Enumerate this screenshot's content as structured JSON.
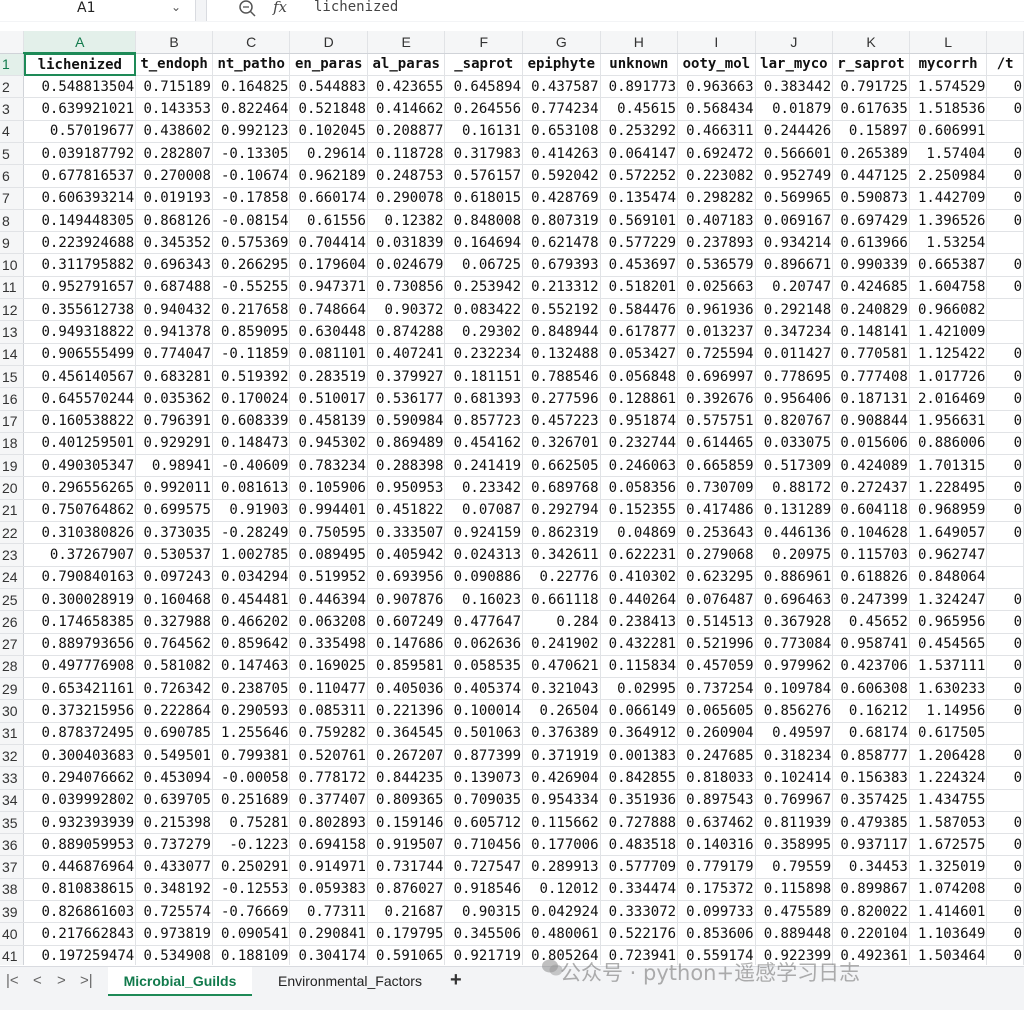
{
  "formula_bar": {
    "cell_ref": "A1",
    "fx_label": "fx",
    "formula": "lichenized"
  },
  "columns": [
    "A",
    "B",
    "C",
    "D",
    "E",
    "F",
    "G",
    "H",
    "I",
    "J",
    "K",
    "L"
  ],
  "headers": [
    "lichenized",
    "t_endoph",
    "nt_patho",
    "en_paras",
    "al_paras",
    "_saprot",
    "epiphyte",
    "unknown",
    "ooty_mol",
    "lar_myco",
    "r_saprot",
    "mycorrh",
    "/t"
  ],
  "rows": [
    [
      "0.548813504",
      "0.715189",
      "0.164825",
      "0.544883",
      "0.423655",
      "0.645894",
      "0.437587",
      "0.891773",
      "0.963663",
      "0.383442",
      "0.791725",
      "1.574529",
      "0"
    ],
    [
      "0.639921021",
      "0.143353",
      "0.822464",
      "0.521848",
      "0.414662",
      "0.264556",
      "0.774234",
      "0.45615",
      "0.568434",
      "0.01879",
      "0.617635",
      "1.518536",
      "0"
    ],
    [
      "0.57019677",
      "0.438602",
      "0.992123",
      "0.102045",
      "0.208877",
      "0.16131",
      "0.653108",
      "0.253292",
      "0.466311",
      "0.244426",
      "0.15897",
      "0.606991",
      ""
    ],
    [
      "0.039187792",
      "0.282807",
      "-0.13305",
      "0.29614",
      "0.118728",
      "0.317983",
      "0.414263",
      "0.064147",
      "0.692472",
      "0.566601",
      "0.265389",
      "1.57404",
      "0"
    ],
    [
      "0.677816537",
      "0.270008",
      "-0.10674",
      "0.962189",
      "0.248753",
      "0.576157",
      "0.592042",
      "0.572252",
      "0.223082",
      "0.952749",
      "0.447125",
      "2.250984",
      "0"
    ],
    [
      "0.606393214",
      "0.019193",
      "-0.17858",
      "0.660174",
      "0.290078",
      "0.618015",
      "0.428769",
      "0.135474",
      "0.298282",
      "0.569965",
      "0.590873",
      "1.442709",
      "0"
    ],
    [
      "0.149448305",
      "0.868126",
      "-0.08154",
      "0.61556",
      "0.12382",
      "0.848008",
      "0.807319",
      "0.569101",
      "0.407183",
      "0.069167",
      "0.697429",
      "1.396526",
      "0"
    ],
    [
      "0.223924688",
      "0.345352",
      "0.575369",
      "0.704414",
      "0.031839",
      "0.164694",
      "0.621478",
      "0.577229",
      "0.237893",
      "0.934214",
      "0.613966",
      "1.53254",
      ""
    ],
    [
      "0.311795882",
      "0.696343",
      "0.266295",
      "0.179604",
      "0.024679",
      "0.06725",
      "0.679393",
      "0.453697",
      "0.536579",
      "0.896671",
      "0.990339",
      "0.665387",
      "0"
    ],
    [
      "0.952791657",
      "0.687488",
      "-0.55255",
      "0.947371",
      "0.730856",
      "0.253942",
      "0.213312",
      "0.518201",
      "0.025663",
      "0.20747",
      "0.424685",
      "1.604758",
      "0"
    ],
    [
      "0.355612738",
      "0.940432",
      "0.217658",
      "0.748664",
      "0.90372",
      "0.083422",
      "0.552192",
      "0.584476",
      "0.961936",
      "0.292148",
      "0.240829",
      "0.966082",
      ""
    ],
    [
      "0.949318822",
      "0.941378",
      "0.859095",
      "0.630448",
      "0.874288",
      "0.29302",
      "0.848944",
      "0.617877",
      "0.013237",
      "0.347234",
      "0.148141",
      "1.421009",
      ""
    ],
    [
      "0.906555499",
      "0.774047",
      "-0.11859",
      "0.081101",
      "0.407241",
      "0.232234",
      "0.132488",
      "0.053427",
      "0.725594",
      "0.011427",
      "0.770581",
      "1.125422",
      "0"
    ],
    [
      "0.456140567",
      "0.683281",
      "0.519392",
      "0.283519",
      "0.379927",
      "0.181151",
      "0.788546",
      "0.056848",
      "0.696997",
      "0.778695",
      "0.777408",
      "1.017726",
      "0"
    ],
    [
      "0.645570244",
      "0.035362",
      "0.170024",
      "0.510017",
      "0.536177",
      "0.681393",
      "0.277596",
      "0.128861",
      "0.392676",
      "0.956406",
      "0.187131",
      "2.016469",
      "0"
    ],
    [
      "0.160538822",
      "0.796391",
      "0.608339",
      "0.458139",
      "0.590984",
      "0.857723",
      "0.457223",
      "0.951874",
      "0.575751",
      "0.820767",
      "0.908844",
      "1.956631",
      "0"
    ],
    [
      "0.401259501",
      "0.929291",
      "0.148473",
      "0.945302",
      "0.869489",
      "0.454162",
      "0.326701",
      "0.232744",
      "0.614465",
      "0.033075",
      "0.015606",
      "0.886006",
      "0"
    ],
    [
      "0.490305347",
      "0.98941",
      "-0.40609",
      "0.783234",
      "0.288398",
      "0.241419",
      "0.662505",
      "0.246063",
      "0.665859",
      "0.517309",
      "0.424089",
      "1.701315",
      "0"
    ],
    [
      "0.296556265",
      "0.992011",
      "0.081613",
      "0.105906",
      "0.950953",
      "0.23342",
      "0.689768",
      "0.058356",
      "0.730709",
      "0.88172",
      "0.272437",
      "1.228495",
      "0"
    ],
    [
      "0.750764862",
      "0.699575",
      "0.91903",
      "0.994401",
      "0.451822",
      "0.07087",
      "0.292794",
      "0.152355",
      "0.417486",
      "0.131289",
      "0.604118",
      "0.968959",
      "0"
    ],
    [
      "0.310380826",
      "0.373035",
      "-0.28249",
      "0.750595",
      "0.333507",
      "0.924159",
      "0.862319",
      "0.04869",
      "0.253643",
      "0.446136",
      "0.104628",
      "1.649057",
      "0"
    ],
    [
      "0.37267907",
      "0.530537",
      "1.002785",
      "0.089495",
      "0.405942",
      "0.024313",
      "0.342611",
      "0.622231",
      "0.279068",
      "0.20975",
      "0.115703",
      "0.962747",
      ""
    ],
    [
      "0.790840163",
      "0.097243",
      "0.034294",
      "0.519952",
      "0.693956",
      "0.090886",
      "0.22776",
      "0.410302",
      "0.623295",
      "0.886961",
      "0.618826",
      "0.848064",
      ""
    ],
    [
      "0.300028919",
      "0.160468",
      "0.454481",
      "0.446394",
      "0.907876",
      "0.16023",
      "0.661118",
      "0.440264",
      "0.076487",
      "0.696463",
      "0.247399",
      "1.324247",
      "0"
    ],
    [
      "0.174658385",
      "0.327988",
      "0.466202",
      "0.063208",
      "0.607249",
      "0.477647",
      "0.284",
      "0.238413",
      "0.514513",
      "0.367928",
      "0.45652",
      "0.965956",
      "0"
    ],
    [
      "0.889793656",
      "0.764562",
      "0.859642",
      "0.335498",
      "0.147686",
      "0.062636",
      "0.241902",
      "0.432281",
      "0.521996",
      "0.773084",
      "0.958741",
      "0.454565",
      "0"
    ],
    [
      "0.497776908",
      "0.581082",
      "0.147463",
      "0.169025",
      "0.859581",
      "0.058535",
      "0.470621",
      "0.115834",
      "0.457059",
      "0.979962",
      "0.423706",
      "1.537111",
      "0"
    ],
    [
      "0.653421161",
      "0.726342",
      "0.238705",
      "0.110477",
      "0.405036",
      "0.405374",
      "0.321043",
      "0.02995",
      "0.737254",
      "0.109784",
      "0.606308",
      "1.630233",
      "0"
    ],
    [
      "0.373215956",
      "0.222864",
      "0.290593",
      "0.085311",
      "0.221396",
      "0.100014",
      "0.26504",
      "0.066149",
      "0.065605",
      "0.856276",
      "0.16212",
      "1.14956",
      "0"
    ],
    [
      "0.878372495",
      "0.690785",
      "1.255646",
      "0.759282",
      "0.364545",
      "0.501063",
      "0.376389",
      "0.364912",
      "0.260904",
      "0.49597",
      "0.68174",
      "0.617505",
      ""
    ],
    [
      "0.300403683",
      "0.549501",
      "0.799381",
      "0.520761",
      "0.267207",
      "0.877399",
      "0.371919",
      "0.001383",
      "0.247685",
      "0.318234",
      "0.858777",
      "1.206428",
      "0"
    ],
    [
      "0.294076662",
      "0.453094",
      "-0.00058",
      "0.778172",
      "0.844235",
      "0.139073",
      "0.426904",
      "0.842855",
      "0.818033",
      "0.102414",
      "0.156383",
      "1.224324",
      "0"
    ],
    [
      "0.039992802",
      "0.639705",
      "0.251689",
      "0.377407",
      "0.809365",
      "0.709035",
      "0.954334",
      "0.351936",
      "0.897543",
      "0.769967",
      "0.357425",
      "1.434755",
      ""
    ],
    [
      "0.932393939",
      "0.215398",
      "0.75281",
      "0.802893",
      "0.159146",
      "0.605712",
      "0.115662",
      "0.727888",
      "0.637462",
      "0.811939",
      "0.479385",
      "1.587053",
      "0"
    ],
    [
      "0.889059953",
      "0.737279",
      "-0.1223",
      "0.694158",
      "0.919507",
      "0.710456",
      "0.177006",
      "0.483518",
      "0.140316",
      "0.358995",
      "0.937117",
      "1.672575",
      "0"
    ],
    [
      "0.446876964",
      "0.433077",
      "0.250291",
      "0.914971",
      "0.731744",
      "0.727547",
      "0.289913",
      "0.577709",
      "0.779179",
      "0.79559",
      "0.34453",
      "1.325019",
      "0"
    ],
    [
      "0.810838615",
      "0.348192",
      "-0.12553",
      "0.059383",
      "0.876027",
      "0.918546",
      "0.12012",
      "0.334474",
      "0.175372",
      "0.115898",
      "0.899867",
      "1.074208",
      "0"
    ],
    [
      "0.826861603",
      "0.725574",
      "-0.76669",
      "0.77311",
      "0.21687",
      "0.90315",
      "0.042924",
      "0.333072",
      "0.099733",
      "0.475589",
      "0.820022",
      "1.414601",
      "0"
    ],
    [
      "0.217662843",
      "0.973819",
      "0.090541",
      "0.290841",
      "0.179795",
      "0.345506",
      "0.480061",
      "0.522176",
      "0.853606",
      "0.889448",
      "0.220104",
      "1.103649",
      "0"
    ],
    [
      "0.197259474",
      "0.534908",
      "0.188109",
      "0.304174",
      "0.591065",
      "0.921719",
      "0.805264",
      "0.723941",
      "0.559174",
      "0.922399",
      "0.492361",
      "1.503464",
      "0"
    ]
  ],
  "sheet_tabs": {
    "active": "Microbial_Guilds",
    "other": "Environmental_Factors",
    "add": "+"
  },
  "nav": {
    "first": "|<",
    "prev": "<",
    "next": ">",
    "last": ">|"
  },
  "watermark": "公众号 · python+遥感学习日志",
  "colors": {
    "accent": "#1e8a57",
    "header_bg": "#f5f6f7",
    "grid_line": "#e1e3e6"
  }
}
